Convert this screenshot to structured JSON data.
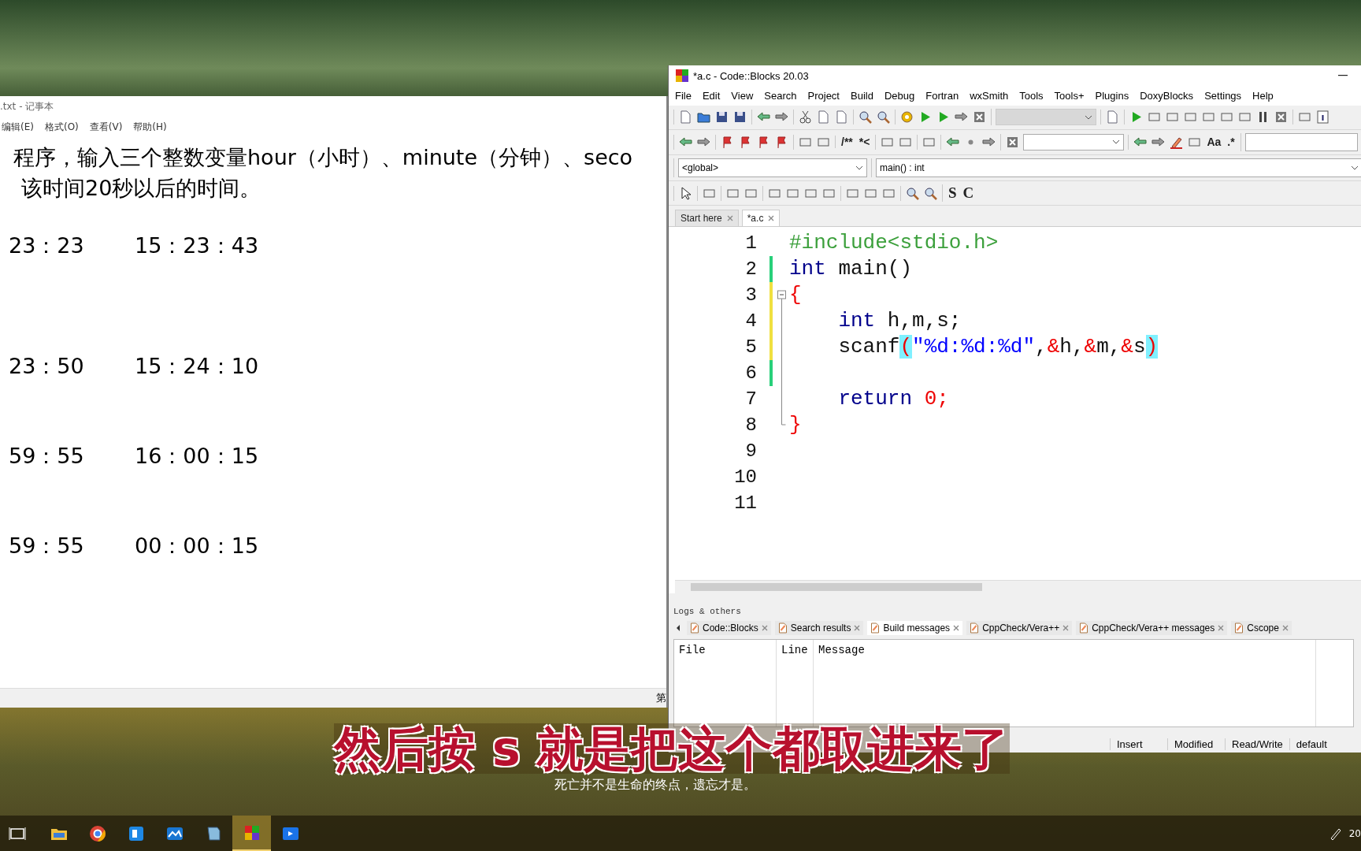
{
  "notepad": {
    "title": ".txt - 记事本",
    "menu": [
      "编辑(E)",
      "格式(O)",
      "查看(V)",
      "帮助(H)"
    ],
    "intro": [
      "程序，输入三个整数变量hour（小时）、minute（分钟）、seco",
      "该时间20秒以后的时间。"
    ],
    "examples": [
      {
        "input": "23：23",
        "output": "15：23：43"
      },
      {
        "input": "23：50",
        "output": "15：24：10"
      },
      {
        "input": "59：55",
        "output": "16：00：15"
      },
      {
        "input": "59：55",
        "output": "00：00：15"
      }
    ],
    "status": "第"
  },
  "codeblocks": {
    "title": "*a.c - Code::Blocks 20.03",
    "menu": [
      "File",
      "Edit",
      "View",
      "Search",
      "Project",
      "Build",
      "Debug",
      "Fortran",
      "wxSmith",
      "Tools",
      "Tools+",
      "Plugins",
      "DoxyBlocks",
      "Settings",
      "Help"
    ],
    "toolbars": [
      {
        "groups": [
          [
            {
              "kind": "icon"
            },
            {
              "kind": "icon"
            },
            {
              "kind": "icon"
            },
            {
              "kind": "icon"
            }
          ],
          [
            {
              "kind": "icon"
            },
            {
              "kind": "icon"
            }
          ],
          [
            {
              "kind": "icon"
            },
            {
              "kind": "icon"
            },
            {
              "kind": "icon"
            }
          ],
          [
            {
              "kind": "icon"
            },
            {
              "kind": "icon"
            }
          ],
          [
            {
              "kind": "icon"
            },
            {
              "kind": "icon"
            },
            {
              "kind": "icon"
            },
            {
              "kind": "icon"
            },
            {
              "kind": "icon"
            }
          ],
          [
            {
              "kind": "combo",
              "disabled": true
            }
          ],
          [
            {
              "kind": "icon"
            }
          ],
          [
            {
              "kind": "icon"
            },
            {
              "kind": "icon"
            },
            {
              "kind": "icon"
            },
            {
              "kind": "icon"
            },
            {
              "kind": "icon"
            },
            {
              "kind": "icon"
            },
            {
              "kind": "icon"
            },
            {
              "kind": "icon"
            },
            {
              "kind": "icon"
            }
          ],
          [
            {
              "kind": "icon"
            },
            {
              "kind": "icon"
            }
          ]
        ]
      },
      {
        "groups": [
          [
            {
              "kind": "icon"
            },
            {
              "kind": "icon"
            }
          ],
          [
            {
              "kind": "icon"
            },
            {
              "kind": "icon"
            },
            {
              "kind": "icon"
            },
            {
              "kind": "icon"
            }
          ],
          [
            {
              "kind": "icon"
            },
            {
              "kind": "icon"
            }
          ],
          [
            {
              "kind": "text",
              "label": "/**"
            },
            {
              "kind": "text",
              "label": "*<"
            }
          ],
          [
            {
              "kind": "icon"
            },
            {
              "kind": "icon"
            }
          ],
          [
            {
              "kind": "icon"
            }
          ],
          [
            {
              "kind": "icon"
            },
            {
              "kind": "icon"
            },
            {
              "kind": "icon"
            }
          ],
          [
            {
              "kind": "icon"
            },
            {
              "kind": "combo",
              "disabled": false
            }
          ],
          [
            {
              "kind": "icon"
            },
            {
              "kind": "icon"
            },
            {
              "kind": "icon"
            },
            {
              "kind": "icon"
            },
            {
              "kind": "text",
              "label": "Aa"
            },
            {
              "kind": "text",
              "label": ".*"
            }
          ],
          [
            {
              "kind": "field"
            }
          ]
        ]
      },
      {
        "groups": [
          [
            {
              "kind": "combo",
              "disabled": false,
              "value": "<global>"
            }
          ],
          [
            {
              "kind": "combo",
              "disabled": false,
              "value": "main() : int"
            }
          ]
        ]
      },
      {
        "groups": [
          [
            {
              "kind": "icon"
            }
          ],
          [
            {
              "kind": "icon"
            }
          ],
          [
            {
              "kind": "icon"
            },
            {
              "kind": "icon"
            }
          ],
          [
            {
              "kind": "icon"
            },
            {
              "kind": "icon"
            },
            {
              "kind": "icon"
            },
            {
              "kind": "icon"
            }
          ],
          [
            {
              "kind": "icon"
            },
            {
              "kind": "icon"
            },
            {
              "kind": "icon"
            }
          ],
          [
            {
              "kind": "icon"
            },
            {
              "kind": "icon"
            }
          ],
          [
            {
              "kind": "text",
              "label": "S"
            },
            {
              "kind": "text",
              "label": "C"
            }
          ]
        ]
      }
    ],
    "editor_tabs": [
      {
        "label": "Start here",
        "selected": false
      },
      {
        "label": "*a.c",
        "selected": true
      }
    ],
    "code": [
      {
        "number": "1",
        "tokens": [
          {
            "text": "#include<stdio.h>",
            "kind": "preproc"
          }
        ]
      },
      {
        "number": "2",
        "modified": false,
        "tokens": [
          {
            "text": "int",
            "kind": "keyword"
          },
          {
            "text": " main()",
            "kind": "plain"
          }
        ]
      },
      {
        "number": "3",
        "modified": true,
        "fold_start": true,
        "tokens": [
          {
            "text": "{",
            "kind": "operator"
          }
        ]
      },
      {
        "number": "4",
        "modified": true,
        "tokens": [
          {
            "text": "    int",
            "kind": "keyword"
          },
          {
            "text": " h,m,s;",
            "kind": "plain"
          }
        ]
      },
      {
        "number": "5",
        "modified": true,
        "tokens": [
          {
            "text": "    scanf",
            "kind": "plain"
          },
          {
            "text": "(",
            "kind": "match"
          },
          {
            "text": "\"%d:%d:%d\"",
            "kind": "string"
          },
          {
            "text": ",",
            "kind": "plain"
          },
          {
            "text": "&",
            "kind": "operator"
          },
          {
            "text": "h,",
            "kind": "plain"
          },
          {
            "text": "&",
            "kind": "operator"
          },
          {
            "text": "m,",
            "kind": "plain"
          },
          {
            "text": "&",
            "kind": "operator"
          },
          {
            "text": "s",
            "kind": "plain"
          },
          {
            "text": ")",
            "kind": "match"
          }
        ]
      },
      {
        "number": "6",
        "modified": false
      },
      {
        "number": "7",
        "tokens": [
          {
            "text": "    return",
            "kind": "keyword"
          },
          {
            "text": " 0;",
            "kind": "number"
          }
        ]
      },
      {
        "number": "8",
        "fold_end": true,
        "tokens": [
          {
            "text": "}",
            "kind": "operator"
          }
        ]
      },
      {
        "number": "9"
      },
      {
        "number": "10"
      },
      {
        "number": "11"
      }
    ],
    "logs": {
      "title": "Logs & others",
      "tabs": [
        {
          "label": "Code::Blocks",
          "selected": false
        },
        {
          "label": "Search results",
          "selected": false
        },
        {
          "label": "Build messages",
          "selected": true
        },
        {
          "label": "CppCheck/Vera++",
          "selected": false
        },
        {
          "label": "CppCheck/Vera++ messages",
          "selected": false
        },
        {
          "label": "Cscope",
          "selected": false
        }
      ],
      "columns": [
        "File",
        "Line",
        "Message"
      ]
    },
    "status_bar": [
      "Insert",
      "Modified",
      "Read/Write",
      "default"
    ]
  },
  "subtitles": {
    "main": "然后按 s 就是把这个都取进来了",
    "secondary": "死亡并不是生命的终点，遗忘才是。"
  },
  "taskbar": {
    "apps": [
      {
        "selected": false
      },
      {
        "selected": false
      },
      {
        "selected": false
      },
      {
        "selected": false
      },
      {
        "selected": false
      },
      {
        "selected": true
      },
      {
        "selected": false
      }
    ],
    "clock": "20"
  }
}
